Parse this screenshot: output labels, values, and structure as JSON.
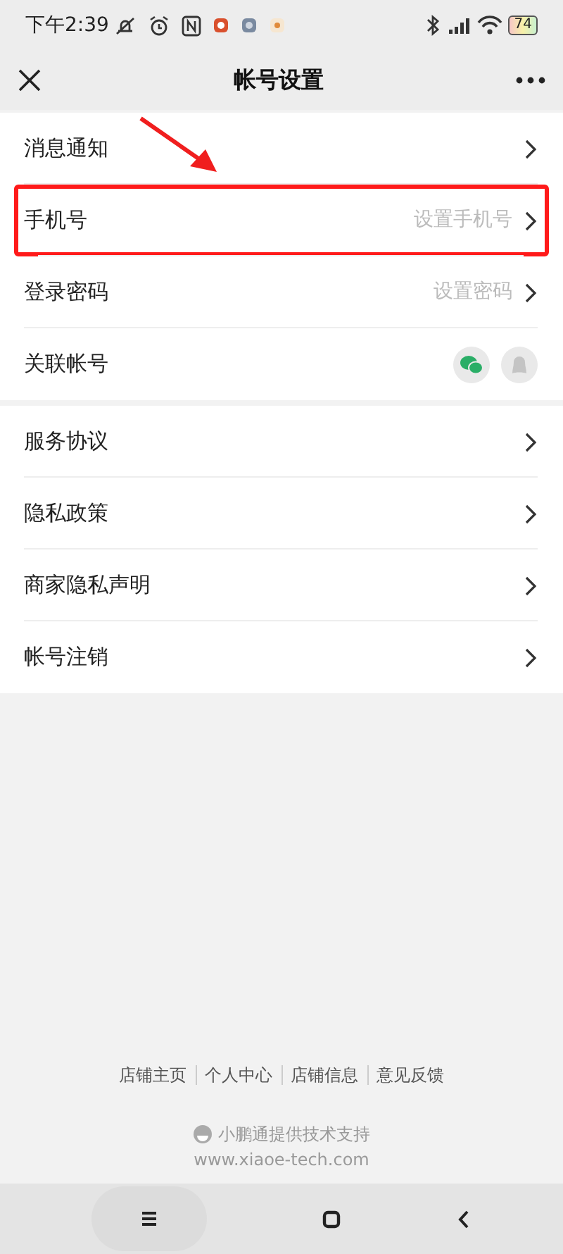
{
  "status_bar": {
    "time": "下午2:39",
    "battery": "74"
  },
  "header": {
    "title": "帐号设置"
  },
  "sections": [
    {
      "rows": [
        {
          "kind": "link",
          "label": "消息通知",
          "highlighted": false
        },
        {
          "kind": "link",
          "label": "手机号",
          "value": "设置手机号",
          "highlighted": true
        },
        {
          "kind": "link",
          "label": "登录密码",
          "value": "设置密码",
          "highlighted": false
        },
        {
          "kind": "accounts",
          "label": "关联帐号",
          "highlighted": false
        }
      ]
    },
    {
      "rows": [
        {
          "kind": "link",
          "label": "服务协议",
          "highlighted": false
        },
        {
          "kind": "link",
          "label": "隐私政策",
          "highlighted": false
        },
        {
          "kind": "link",
          "label": "商家隐私声明",
          "highlighted": false
        },
        {
          "kind": "link",
          "label": "帐号注销",
          "highlighted": false
        }
      ]
    }
  ],
  "footer": {
    "links": [
      "店铺主页",
      "个人中心",
      "店铺信息",
      "意见反馈"
    ],
    "powered_by": "小鹏通提供技术支持",
    "url": "www.xiaoe-tech.com"
  }
}
